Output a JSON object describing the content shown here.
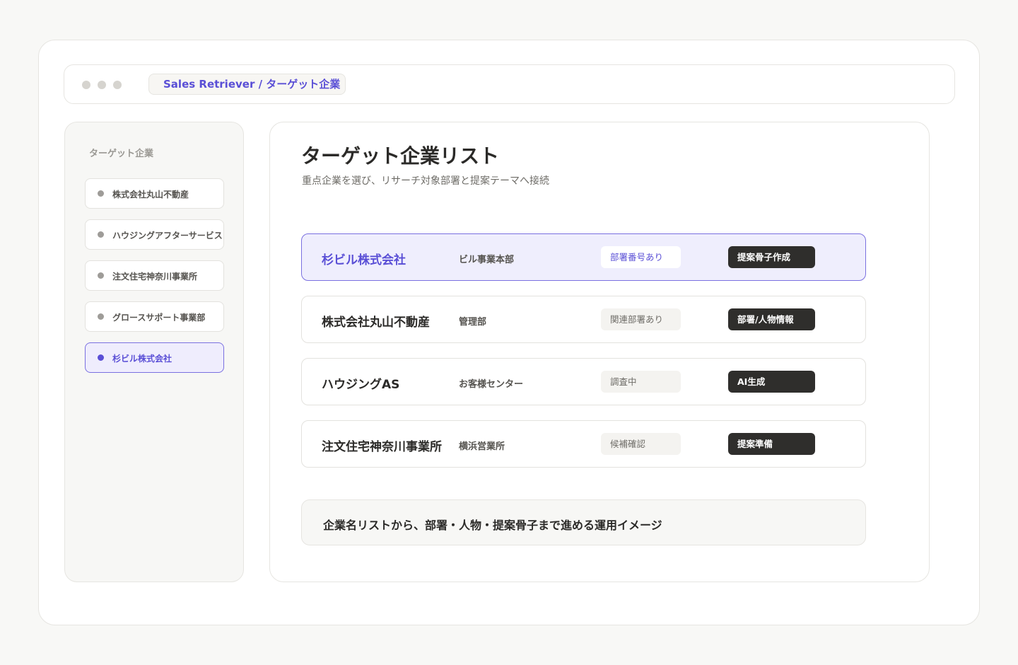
{
  "browser": {
    "breadcrumb": "Sales Retriever / ターゲット企業"
  },
  "sidebar": {
    "title": "ターゲット企業",
    "items": [
      {
        "label": "株式会社丸山不動産"
      },
      {
        "label": "ハウジングアフターサービス"
      },
      {
        "label": "注文住宅神奈川事業所"
      },
      {
        "label": "グロースサポート事業部"
      },
      {
        "label": "杉ビル株式会社"
      }
    ],
    "active_index": 4
  },
  "main": {
    "title": "ターゲット企業リスト",
    "subtitle": "重点企業を選び、リサーチ対象部署と提案テーマへ接続",
    "rows": [
      {
        "company": "杉ビル株式会社",
        "department": "ビル事業本部",
        "status": "部署番号あり",
        "action": "提案骨子作成"
      },
      {
        "company": "株式会社丸山不動産",
        "department": "管理部",
        "status": "関連部署あり",
        "action": "部署/人物情報"
      },
      {
        "company": "ハウジングAS",
        "department": "お客様センター",
        "status": "調査中",
        "action": "AI生成"
      },
      {
        "company": "注文住宅神奈川事業所",
        "department": "横浜営業所",
        "status": "候補確認",
        "action": "提案準備"
      }
    ],
    "active_row": 0,
    "note": "企業名リストから、部署・人物・提案骨子まで進める運用イメージ"
  },
  "colors": {
    "accent": "#5a4fd6",
    "accent_bg": "#efeefd",
    "dark_button": "#2f2e2c",
    "background": "#f8f8f6"
  }
}
